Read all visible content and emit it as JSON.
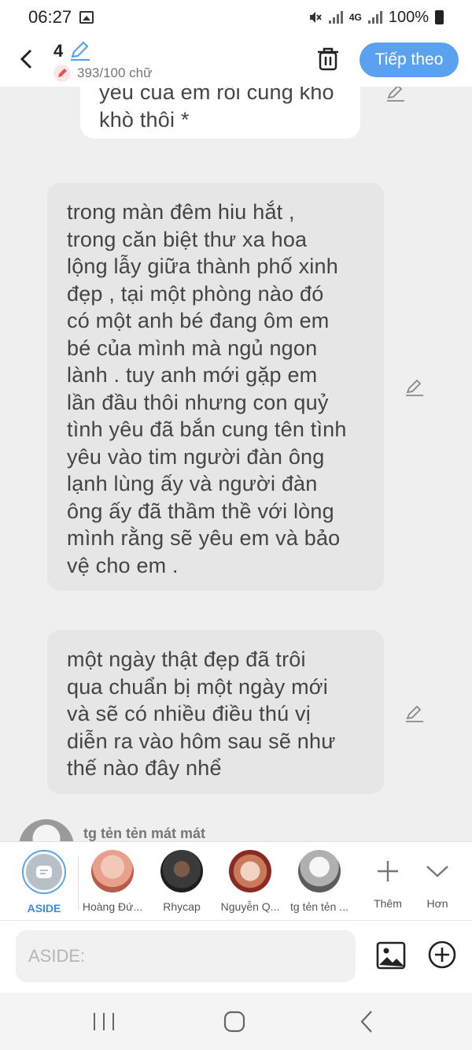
{
  "status_bar": {
    "time": "06:27",
    "network": "4G",
    "battery": "100%"
  },
  "header": {
    "page_number": "4",
    "word_count": "393/100 chữ",
    "next_button": "Tiếp theo"
  },
  "messages": [
    {
      "lines": [
        "yêu của em rồi cũng khó",
        "khò thôi *"
      ],
      "style": "white"
    },
    {
      "lines": [
        "trong màn đêm hiu hắt ,",
        "trong căn biệt thư xa hoa",
        "lộng lẫy giữa thành phố xinh",
        "đẹp , tại một phòng nào đó",
        "có một anh bé đang ôm em",
        "bé của mình mà ngủ ngon",
        "lành . tuy anh mới gặp em",
        "lần đầu thôi nhưng con quỷ",
        "tình yêu đã bắn cung tên tình",
        "yêu vào tim người đàn ông",
        "lạnh lùng ấy và người đàn",
        "ông ấy đã thầm thề với lòng",
        "mình rằng sẽ yêu em và bảo",
        "vệ cho em ."
      ],
      "style": "grey"
    },
    {
      "lines": [
        "một ngày thật đẹp đã trôi",
        "qua chuẩn bị một ngày mới",
        "và sẽ có nhiều điều thú vị",
        "diễn ra vào hôm sau sẽ như",
        "thế nào đây nhể"
      ],
      "style": "grey"
    }
  ],
  "author": {
    "name": "tg tẻn tẻn mát mát"
  },
  "characters": [
    {
      "label": "ASIDE",
      "selected": true
    },
    {
      "label": "Hoàng Đứ...",
      "color": "#e8a08c"
    },
    {
      "label": "Rhycap",
      "color": "#3a3a3a"
    },
    {
      "label": "Nguyễn Q...",
      "color": "#c87a5a"
    },
    {
      "label": "tg tẻn tẻn ...",
      "color": "#8a8a8a"
    }
  ],
  "tools": {
    "add_label": "Thêm",
    "more_label": "Hơn"
  },
  "input": {
    "placeholder": "ASIDE:"
  },
  "colors": {
    "accent": "#5aa2ef",
    "chat_bg": "#efefef",
    "bubble_grey": "#e6e6e6"
  }
}
